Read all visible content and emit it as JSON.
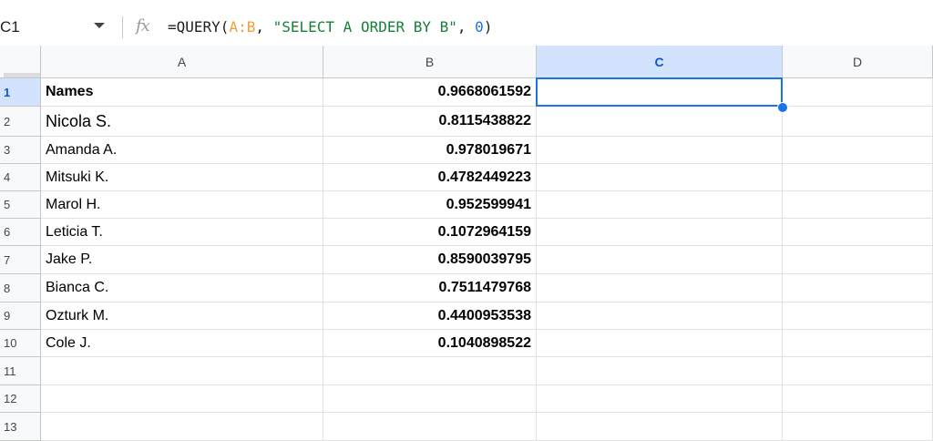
{
  "namebox": "C1",
  "formula": {
    "prefix": "=QUERY(",
    "range": "A:B",
    "sep1": ", ",
    "query": "\"SELECT A ORDER BY B\"",
    "sep2": ", ",
    "headers": "0",
    "suffix": ")"
  },
  "fx_label": "fx",
  "columns": [
    "A",
    "B",
    "C",
    "D"
  ],
  "selected_column": "C",
  "selected_row": "1",
  "rows": [
    {
      "num": "1",
      "a": "Names",
      "b": "0.9668061592"
    },
    {
      "num": "2",
      "a": "Nicola S.",
      "b": "0.8115438822"
    },
    {
      "num": "3",
      "a": "Amanda A.",
      "b": "0.978019671"
    },
    {
      "num": "4",
      "a": "Mitsuki K.",
      "b": "0.4782449223"
    },
    {
      "num": "5",
      "a": "Marol H.",
      "b": "0.952599941"
    },
    {
      "num": "6",
      "a": "Leticia T.",
      "b": "0.1072964159"
    },
    {
      "num": "7",
      "a": "Jake P.",
      "b": "0.8590039795"
    },
    {
      "num": "8",
      "a": "Bianca C.",
      "b": "0.7511479768"
    },
    {
      "num": "9",
      "a": "Ozturk M.",
      "b": "0.4400953538"
    },
    {
      "num": "10",
      "a": "Cole J.",
      "b": "0.1040898522"
    },
    {
      "num": "11",
      "a": "",
      "b": ""
    },
    {
      "num": "12",
      "a": "",
      "b": ""
    },
    {
      "num": "13",
      "a": "",
      "b": ""
    }
  ],
  "colors": {
    "selection": "#1a73e8",
    "selected_header_bg": "#d3e3fd",
    "range_ref": "#f29d38",
    "string_literal": "#188038",
    "number_literal": "#1a73e8"
  }
}
